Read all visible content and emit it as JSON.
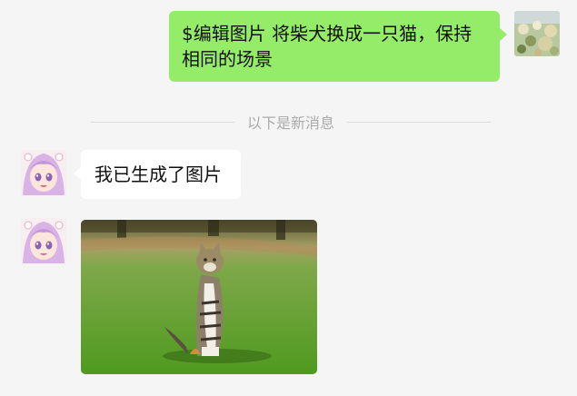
{
  "messages": {
    "outgoing_text": "$编辑图片 将柴犬换成一只猫，保持相同的场景",
    "divider_text": "以下是新消息",
    "incoming_text": "我已生成了图片"
  },
  "colors": {
    "background": "#f5f5f5",
    "outgoing_bubble": "#95ec69",
    "incoming_bubble": "#ffffff"
  },
  "icons": {
    "user_avatar": "flowers-photo-avatar",
    "bot_avatar": "anime-girl-avatar",
    "generated_image": "cat-on-grass-photo"
  }
}
